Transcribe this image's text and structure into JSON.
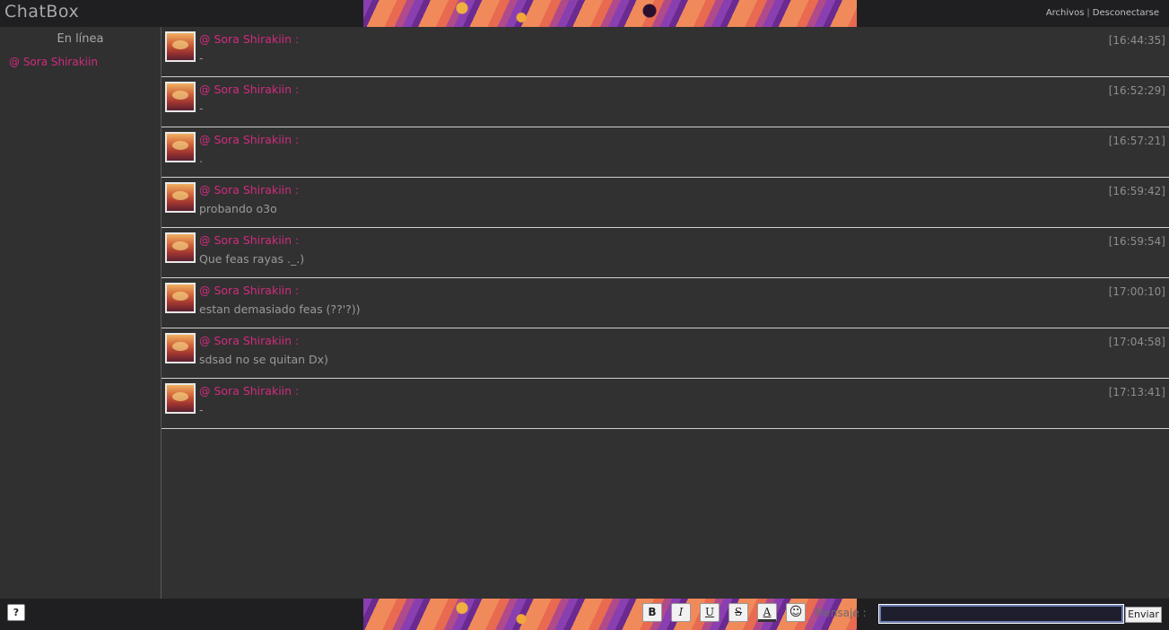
{
  "header": {
    "brand": "ChatBox",
    "links": [
      "Archivos",
      "Desconectarse"
    ],
    "separator": "|"
  },
  "sidebar": {
    "title": "En línea",
    "online_users": [
      "@ Sora Shirakiin"
    ]
  },
  "messages": [
    {
      "user": "@ Sora Shirakiin :",
      "time": "[16:44:35]",
      "text": "-"
    },
    {
      "user": "@ Sora Shirakiin :",
      "time": "[16:52:29]",
      "text": "-"
    },
    {
      "user": "@ Sora Shirakiin :",
      "time": "[16:57:21]",
      "text": "."
    },
    {
      "user": "@ Sora Shirakiin :",
      "time": "[16:59:42]",
      "text": "probando o3o"
    },
    {
      "user": "@ Sora Shirakiin :",
      "time": "[16:59:54]",
      "text": "Que feas rayas ._.)"
    },
    {
      "user": "@ Sora Shirakiin :",
      "time": "[17:00:10]",
      "text": "estan demasiado feas (??'?))"
    },
    {
      "user": "@ Sora Shirakiin :",
      "time": "[17:04:58]",
      "text": "sdsad no se quitan Dx)"
    },
    {
      "user": "@ Sora Shirakiin :",
      "time": "[17:13:41]",
      "text": "-"
    }
  ],
  "footer": {
    "help_label": "?",
    "format_buttons": {
      "bold": "B",
      "italic": "I",
      "underline": "U",
      "strike": "S",
      "color": "A",
      "emoji": "☺"
    },
    "message_label": "Mensaje :",
    "message_value": "",
    "send_label": "Enviar"
  },
  "colors": {
    "username": "#d12b7e",
    "background": "#313131"
  },
  "icons": {
    "emoji": "smiley-icon"
  }
}
